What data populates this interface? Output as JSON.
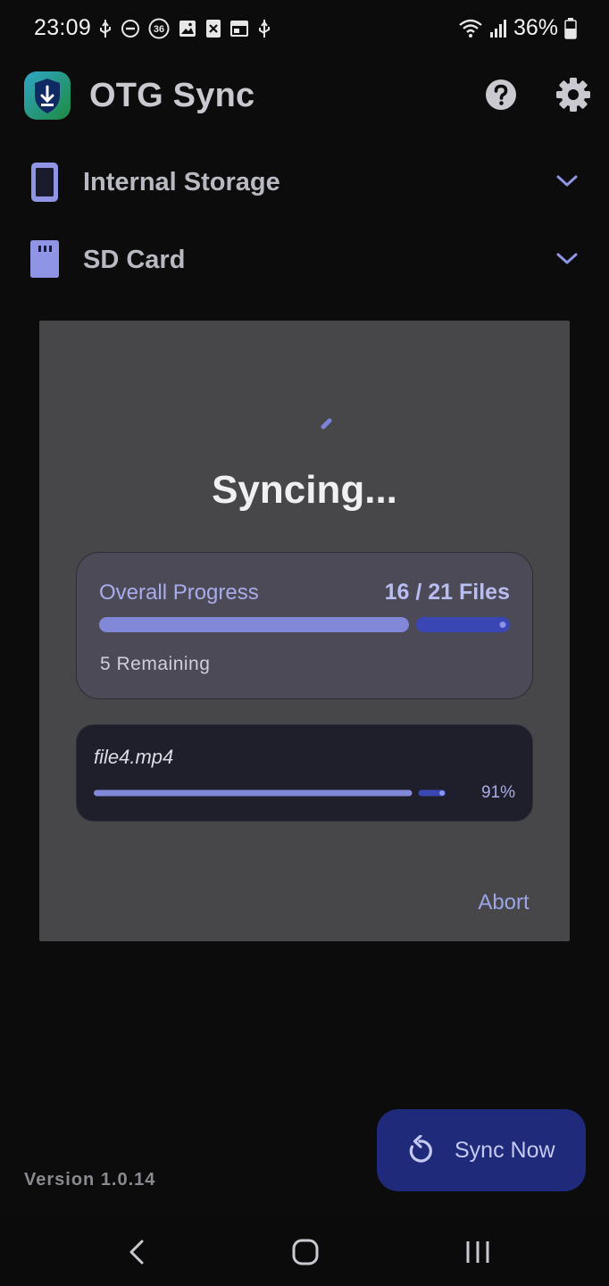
{
  "status_bar": {
    "time": "23:09",
    "battery": "36%",
    "left_icons": [
      "usb-icon",
      "do-not-disturb-icon",
      "notification-count-icon",
      "gallery-icon",
      "excel-icon",
      "calendar-icon",
      "usb-icon"
    ],
    "notification_count": "36",
    "right_icons": [
      "wifi-icon",
      "signal-icon",
      "battery-icon"
    ]
  },
  "app_bar": {
    "title": "OTG Sync",
    "actions": [
      "help-icon",
      "settings-icon"
    ]
  },
  "storage": [
    {
      "label": "Internal Storage",
      "icon": "phone-icon"
    },
    {
      "label": "SD Card",
      "icon": "sd-card-icon"
    }
  ],
  "dialog": {
    "title": "Syncing...",
    "overall": {
      "label": "Overall Progress",
      "count": "16 / 21 Files",
      "remaining": "5 Remaining",
      "progress": 0.762
    },
    "current_file": {
      "name": "file4.mp4",
      "percent_label": "91%",
      "progress": 0.91
    },
    "abort_label": "Abort"
  },
  "fab": {
    "label": "Sync Now",
    "icon": "refresh-icon"
  },
  "version": "Version 1.0.14",
  "nav": [
    "back-icon",
    "home-icon",
    "recents-icon"
  ],
  "colors": {
    "accent": "#7b82d8",
    "accent_dark": "#3c48b8",
    "fab_bg": "#1f2a7a"
  }
}
